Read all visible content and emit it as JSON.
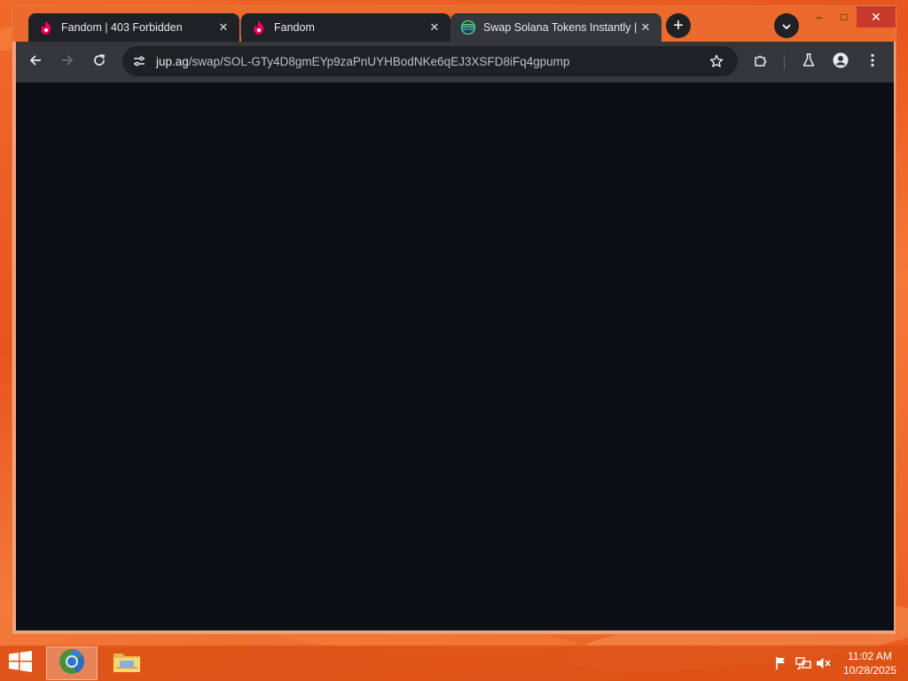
{
  "browser": {
    "tabs": [
      {
        "title": "Fandom | 403 Forbidden",
        "favicon": "fandom-flame-icon",
        "active": false
      },
      {
        "title": "Fandom",
        "favicon": "fandom-flame-icon",
        "active": false
      },
      {
        "title": "Swap Solana Tokens Instantly | J",
        "favicon": "jupiter-icon",
        "active": true
      }
    ],
    "close_glyph": "✕",
    "new_tab_glyph": "+",
    "address": {
      "host": "jup.ag",
      "path": "/swap/SOL-GTy4D8gmEYp9zaPnUYHBodNKe6qEJ3XSFD8iFq4gpump"
    },
    "window_controls": {
      "minimize": "–",
      "maximize": "□",
      "close": "✕"
    }
  },
  "colors": {
    "page_background": "#0b0e14",
    "tab_active": "#35363a",
    "tab_inactive": "#202124",
    "titlebar": "#ec6a2c",
    "fandom_pink": "#fa005a",
    "jupiter_green": "#2ee6b0"
  },
  "taskbar": {
    "time": "11:02 AM",
    "date": "10/28/2025"
  }
}
